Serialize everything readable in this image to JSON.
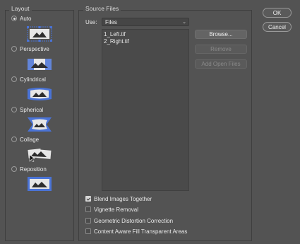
{
  "layout": {
    "title": "Layout",
    "options": [
      {
        "label": "Auto",
        "selected": true,
        "icon": "auto-layout-icon"
      },
      {
        "label": "Perspective",
        "selected": false,
        "icon": "perspective-layout-icon"
      },
      {
        "label": "Cylindrical",
        "selected": false,
        "icon": "cylindrical-layout-icon"
      },
      {
        "label": "Spherical",
        "selected": false,
        "icon": "spherical-layout-icon"
      },
      {
        "label": "Collage",
        "selected": false,
        "icon": "collage-layout-icon"
      },
      {
        "label": "Reposition",
        "selected": false,
        "icon": "reposition-layout-icon"
      }
    ]
  },
  "source": {
    "title": "Source Files",
    "use_label": "Use:",
    "use_value": "Files",
    "files": [
      "1_Left.tif",
      "2_Right.tif"
    ],
    "browse_label": "Browse...",
    "remove_label": "Remove",
    "add_open_label": "Add Open Files"
  },
  "options": [
    {
      "label": "Blend Images Together",
      "checked": true
    },
    {
      "label": "Vignette Removal",
      "checked": false
    },
    {
      "label": "Geometric Distortion Correction",
      "checked": false
    },
    {
      "label": "Content Aware Fill Transparent Areas",
      "checked": false
    }
  ],
  "dialog": {
    "ok_label": "OK",
    "cancel_label": "Cancel"
  },
  "colors": {
    "background": "#535353",
    "icon_blue": "#4a73d6",
    "icon_light": "#e6e6e6"
  }
}
